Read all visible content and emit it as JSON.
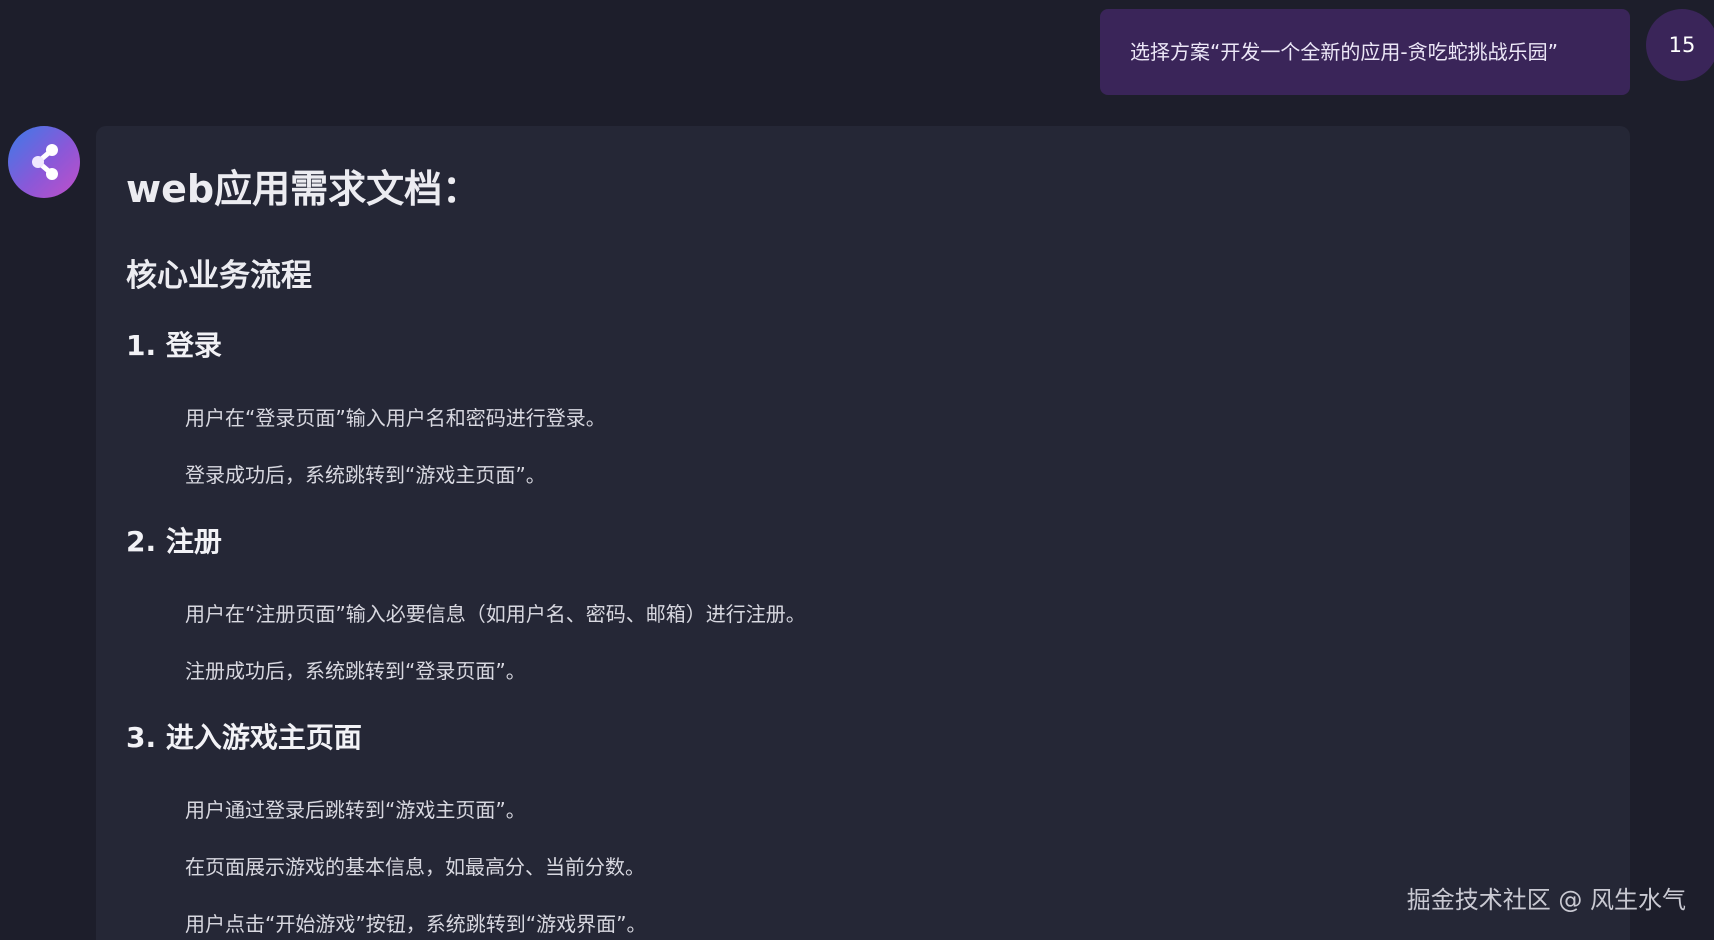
{
  "user_message": {
    "text": "选择方案“开发一个全新的应用-贪吃蛇挑战乐园”",
    "avatar_label": "15"
  },
  "assistant": {
    "avatar_icon": "share-icon",
    "title": "web应用需求文档：",
    "section_heading": "核心业务流程",
    "steps": [
      {
        "heading": "1. 登录",
        "lines": [
          "用户在“登录页面”输入用户名和密码进行登录。",
          "登录成功后，系统跳转到“游戏主页面”。"
        ]
      },
      {
        "heading": "2. 注册",
        "lines": [
          "用户在“注册页面”输入必要信息（如用户名、密码、邮箱）进行注册。",
          "注册成功后，系统跳转到“登录页面”。"
        ]
      },
      {
        "heading": "3. 进入游戏主页面",
        "lines": [
          "用户通过登录后跳转到“游戏主页面”。",
          "在页面展示游戏的基本信息，如最高分、当前分数。",
          "用户点击“开始游戏”按钮，系统跳转到“游戏界面”。"
        ]
      }
    ]
  },
  "watermark": "掘金技术社区 @ 风生水气"
}
